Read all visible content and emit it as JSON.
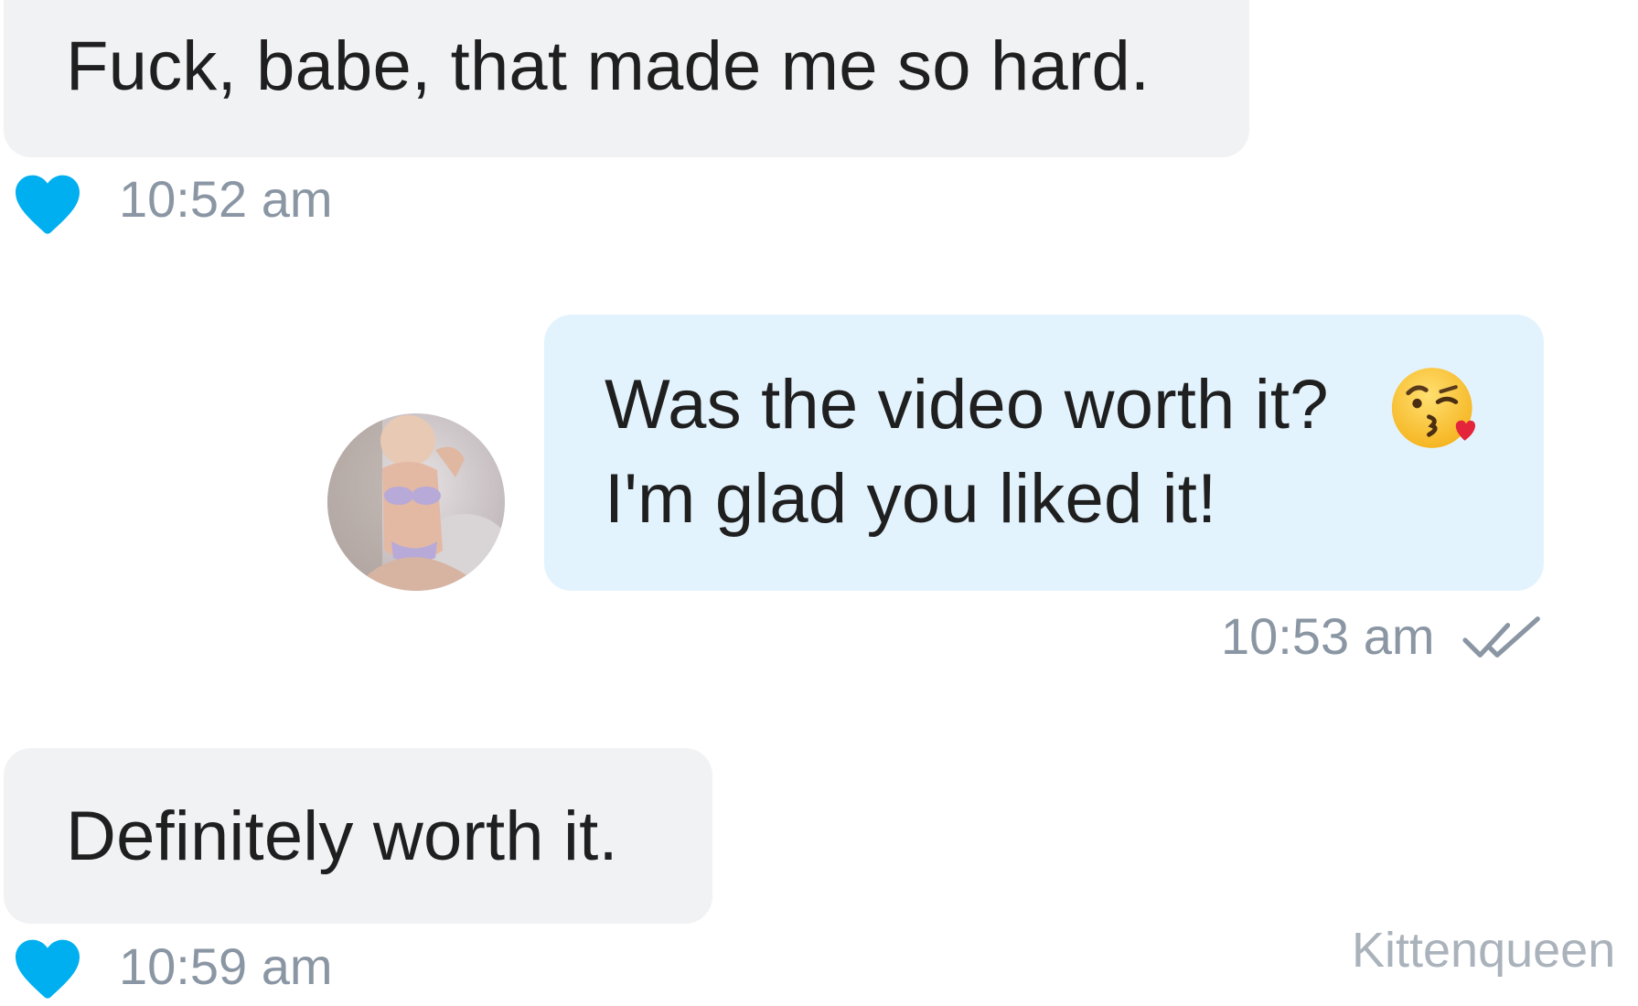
{
  "messages": [
    {
      "direction": "incoming",
      "text": "Fuck, babe, that made me so hard.",
      "time": "10:52 am",
      "liked": true
    },
    {
      "direction": "outgoing",
      "lines": [
        "Was the video worth it?",
        "I'm glad you liked it!"
      ],
      "emoji": "kissing-face-with-heart-emoji",
      "time": "10:53 am",
      "read_receipt": "double-check-icon"
    },
    {
      "direction": "incoming",
      "text": "Definitely worth it.",
      "time": "10:59 am",
      "liked": true
    }
  ],
  "watermark": "Kittenqueen",
  "colors": {
    "incoming_bubble": "#f1f2f4",
    "outgoing_bubble": "#e3f3fd",
    "heart": "#00aff0",
    "timestamp": "#8a96a3"
  }
}
